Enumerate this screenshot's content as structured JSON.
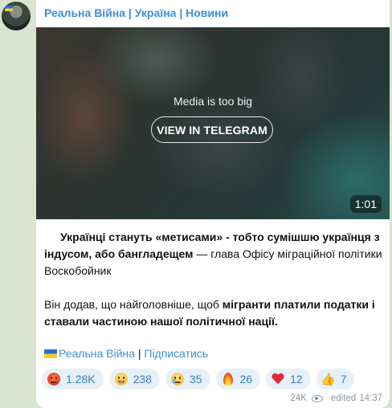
{
  "channel": {
    "title": "Реальна Війна | Україна | Новини"
  },
  "media": {
    "note": "Media is too big",
    "view_button_label": "VIEW IN TELEGRAM",
    "duration": "1:01"
  },
  "post": {
    "p1_bold": "Українці стануть «метисами» - тобто сумішшю українця з індусом, або бангладещем",
    "p1_rest": " — глава Офісу міграційної політики Воскобойник",
    "p2_start": "Він додав, що найголовніше, щоб ",
    "p2_bold": "мігранти платили податки і ставали частиною нашої політичної нації."
  },
  "signature": {
    "channel_link": "Реальна Війна",
    "separator": " | ",
    "subscribe_link": "Підписатись"
  },
  "reactions": [
    {
      "icon": "angry-face-icon",
      "count": "1.28K"
    },
    {
      "icon": "grinning-face-icon",
      "count": "238"
    },
    {
      "icon": "crying-face-icon",
      "count": "35"
    },
    {
      "icon": "fire-icon",
      "count": "26"
    },
    {
      "icon": "heart-icon",
      "count": "12"
    },
    {
      "icon": "thumbs-up-icon",
      "count": "7"
    }
  ],
  "meta": {
    "views": "24K",
    "edited_label": "edited",
    "time": "14:37"
  },
  "colors": {
    "link": "#3d8fd4",
    "background": "#d9e3cf",
    "reaction_bg": "#e6f0f8"
  }
}
